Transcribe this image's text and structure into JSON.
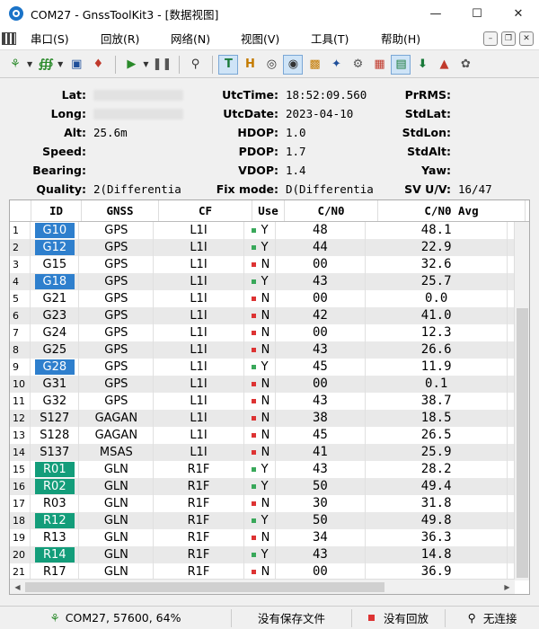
{
  "window": {
    "title": "COM27 - GnssToolKit3 - [数据视图]"
  },
  "menu": {
    "items": [
      "串口(S)",
      "回放(R)",
      "网络(N)",
      "视图(V)",
      "工具(T)",
      "帮助(H)"
    ]
  },
  "toolbar": {
    "icons": [
      "connect-icon",
      "signal-icon",
      "save-icon",
      "tag-icon",
      "play-icon",
      "pause-icon",
      "gps-icon",
      "text-view-icon",
      "hex-view-icon",
      "target-icon",
      "compass-icon",
      "bar-chart-icon",
      "satellite-icon",
      "gear-icon",
      "table-icon",
      "grid-icon",
      "download-icon",
      "arrow-icon",
      "bird-icon"
    ]
  },
  "info": {
    "lat_label": "Lat:",
    "lat_value": "",
    "long_label": "Long:",
    "long_value": "",
    "alt_label": "Alt:",
    "alt_value": "25.6m",
    "speed_label": "Speed:",
    "speed_value": "",
    "bearing_label": "Bearing:",
    "bearing_value": "",
    "quality_label": "Quality:",
    "quality_value": "2(Differentia",
    "utctime_label": "UtcTime:",
    "utctime_value": "18:52:09.560",
    "utcdate_label": "UtcDate:",
    "utcdate_value": "2023-04-10",
    "hdop_label": "HDOP:",
    "hdop_value": "1.0",
    "pdop_label": "PDOP:",
    "pdop_value": "1.7",
    "vdop_label": "VDOP:",
    "vdop_value": "1.4",
    "fixmode_label": "Fix mode:",
    "fixmode_value": "D(Differentia",
    "prrms_label": "PrRMS:",
    "prrms_value": "",
    "stdlat_label": "StdLat:",
    "stdlat_value": "",
    "stdlon_label": "StdLon:",
    "stdlon_value": "",
    "stdalt_label": "StdAlt:",
    "stdalt_value": "",
    "yaw_label": "Yaw:",
    "yaw_value": "",
    "svuv_label": "SV U/V:",
    "svuv_value": "16/47"
  },
  "table": {
    "headers": [
      "ID",
      "GNSS",
      "CF",
      "Use",
      "C/N0",
      "C/N0 Avg"
    ],
    "rows": [
      {
        "n": "1",
        "id": "G10",
        "gnss": "GPS",
        "cf": "L1I",
        "use": "Y",
        "cn0": "48",
        "avg": "48.1"
      },
      {
        "n": "2",
        "id": "G12",
        "gnss": "GPS",
        "cf": "L1I",
        "use": "Y",
        "cn0": "44",
        "avg": "22.9"
      },
      {
        "n": "3",
        "id": "G15",
        "gnss": "GPS",
        "cf": "L1I",
        "use": "N",
        "cn0": "00",
        "avg": "32.6"
      },
      {
        "n": "4",
        "id": "G18",
        "gnss": "GPS",
        "cf": "L1I",
        "use": "Y",
        "cn0": "43",
        "avg": "25.7"
      },
      {
        "n": "5",
        "id": "G21",
        "gnss": "GPS",
        "cf": "L1I",
        "use": "N",
        "cn0": "00",
        "avg": "0.0"
      },
      {
        "n": "6",
        "id": "G23",
        "gnss": "GPS",
        "cf": "L1I",
        "use": "N",
        "cn0": "42",
        "avg": "41.0"
      },
      {
        "n": "7",
        "id": "G24",
        "gnss": "GPS",
        "cf": "L1I",
        "use": "N",
        "cn0": "00",
        "avg": "12.3"
      },
      {
        "n": "8",
        "id": "G25",
        "gnss": "GPS",
        "cf": "L1I",
        "use": "N",
        "cn0": "43",
        "avg": "26.6"
      },
      {
        "n": "9",
        "id": "G28",
        "gnss": "GPS",
        "cf": "L1I",
        "use": "Y",
        "cn0": "45",
        "avg": "11.9"
      },
      {
        "n": "10",
        "id": "G31",
        "gnss": "GPS",
        "cf": "L1I",
        "use": "N",
        "cn0": "00",
        "avg": "0.1"
      },
      {
        "n": "11",
        "id": "G32",
        "gnss": "GPS",
        "cf": "L1I",
        "use": "N",
        "cn0": "43",
        "avg": "38.7"
      },
      {
        "n": "12",
        "id": "S127",
        "gnss": "GAGAN",
        "cf": "L1I",
        "use": "N",
        "cn0": "38",
        "avg": "18.5"
      },
      {
        "n": "13",
        "id": "S128",
        "gnss": "GAGAN",
        "cf": "L1I",
        "use": "N",
        "cn0": "45",
        "avg": "26.5"
      },
      {
        "n": "14",
        "id": "S137",
        "gnss": "MSAS",
        "cf": "L1I",
        "use": "N",
        "cn0": "41",
        "avg": "25.9"
      },
      {
        "n": "15",
        "id": "R01",
        "gnss": "GLN",
        "cf": "R1F",
        "use": "Y",
        "cn0": "43",
        "avg": "28.2"
      },
      {
        "n": "16",
        "id": "R02",
        "gnss": "GLN",
        "cf": "R1F",
        "use": "Y",
        "cn0": "50",
        "avg": "49.4"
      },
      {
        "n": "17",
        "id": "R03",
        "gnss": "GLN",
        "cf": "R1F",
        "use": "N",
        "cn0": "30",
        "avg": "31.8"
      },
      {
        "n": "18",
        "id": "R12",
        "gnss": "GLN",
        "cf": "R1F",
        "use": "Y",
        "cn0": "50",
        "avg": "49.8"
      },
      {
        "n": "19",
        "id": "R13",
        "gnss": "GLN",
        "cf": "R1F",
        "use": "N",
        "cn0": "34",
        "avg": "36.3"
      },
      {
        "n": "20",
        "id": "R14",
        "gnss": "GLN",
        "cf": "R1F",
        "use": "Y",
        "cn0": "43",
        "avg": "14.8"
      },
      {
        "n": "21",
        "id": "R17",
        "gnss": "GLN",
        "cf": "R1F",
        "use": "N",
        "cn0": "00",
        "avg": "36.9"
      }
    ]
  },
  "status": {
    "port": "COM27, 57600, 64%",
    "save": "没有保存文件",
    "playback": "没有回放",
    "network": "无连接"
  },
  "colors": {
    "gps_used": "#2e7fcd",
    "glonass_used": "#139d7a",
    "use_yes": "#39a85a",
    "use_no": "#dd3333"
  }
}
